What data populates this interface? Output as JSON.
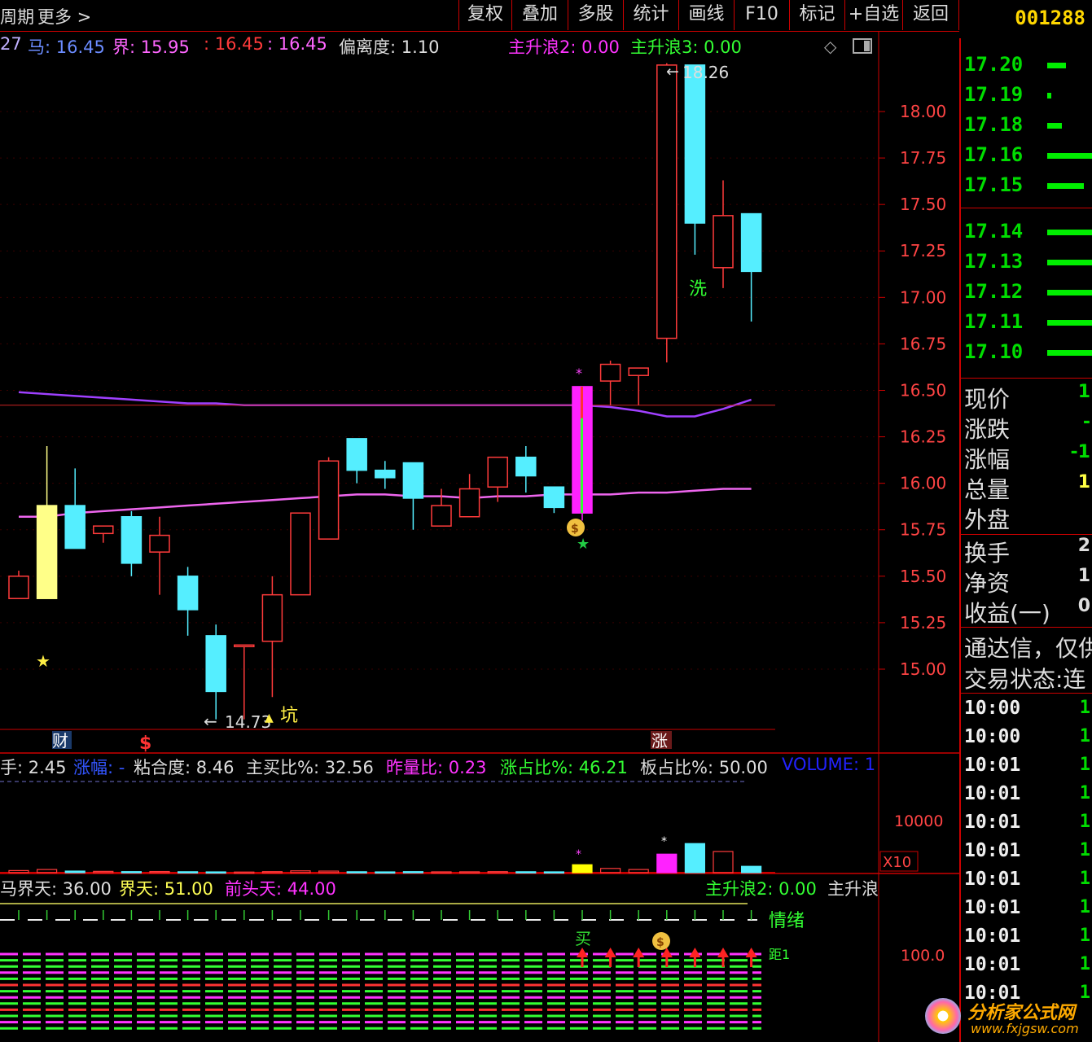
{
  "toolbar": {
    "left_items": [
      "周期",
      "更多 >"
    ],
    "buttons": [
      "复权",
      "叠加",
      "多股",
      "统计",
      "画线",
      "F10",
      "标记",
      "+自选",
      "返回"
    ]
  },
  "stock_code": "001288",
  "indicators": {
    "main": [
      {
        "text": "27",
        "color": "#c0b0ff"
      },
      {
        "text": "马: 16.45",
        "color": "#6b8cff"
      },
      {
        "text": "界: 15.95",
        "color": "#ff66ff"
      },
      {
        "text": ": 16.45",
        "color": "#ff3b3b"
      },
      {
        "text": ": 16.45",
        "color": "#ff66ff"
      },
      {
        "text": "偏离度: 1.10",
        "color": "#dddddd"
      },
      {
        "text": "主升浪2: 0.00",
        "color": "#ff33ff"
      },
      {
        "text": "主升浪3: 0.00",
        "color": "#33ff33"
      }
    ],
    "volume": [
      {
        "text": "手: 2.45",
        "color": "#dddddd"
      },
      {
        "text": "涨幅: -",
        "color": "#3355ff"
      },
      {
        "text": "粘合度: 8.46",
        "color": "#dddddd"
      },
      {
        "text": "主买比%: 32.56",
        "color": "#dddddd"
      },
      {
        "text": "昨量比: 0.23",
        "color": "#ff33ff"
      },
      {
        "text": "涨占比%: 46.21",
        "color": "#33ff33"
      },
      {
        "text": "板占比%: 50.00",
        "color": "#dddddd"
      },
      {
        "text": "VOLUME: 1",
        "color": "#2222ff"
      }
    ],
    "bottom": [
      {
        "text": "马界天: 36.00",
        "color": "#dddddd"
      },
      {
        "text": "界天: 51.00",
        "color": "#ffff55"
      },
      {
        "text": "前头天: 44.00",
        "color": "#ff33ff"
      },
      {
        "text": "主升浪2: 0.00",
        "color": "#33ff33"
      },
      {
        "text": "主升浪",
        "color": "#dddddd"
      }
    ]
  },
  "price_axis": [
    "18.00",
    "17.75",
    "17.50",
    "17.25",
    "17.00",
    "16.75",
    "16.50",
    "16.25",
    "16.00",
    "15.75",
    "15.50",
    "15.25",
    "15.00"
  ],
  "volume_axis": {
    "value": "10000",
    "multiplier": "X10"
  },
  "bottom_axis": {
    "value": "100.0"
  },
  "chart_labels": {
    "high_marker": "18.26",
    "low_marker": "14.73",
    "keng": "坑",
    "xi": "洗",
    "mai": "买",
    "qingxu": "情绪",
    "zhang": "涨",
    "cai": "财",
    "dollar": "$",
    "ju1": "距1"
  },
  "chart_data": {
    "type": "candlestick",
    "ylim": [
      14.6,
      18.4
    ],
    "candles": [
      {
        "o": 15.38,
        "c": 15.5,
        "h": 15.53,
        "l": 15.38
      },
      {
        "o": 15.38,
        "c": 15.88,
        "h": 16.2,
        "l": 15.38
      },
      {
        "o": 15.88,
        "c": 15.65,
        "h": 16.08,
        "l": 15.65
      },
      {
        "o": 15.73,
        "c": 15.77,
        "h": 15.77,
        "l": 15.68
      },
      {
        "o": 15.82,
        "c": 15.57,
        "h": 15.85,
        "l": 15.5
      },
      {
        "o": 15.63,
        "c": 15.72,
        "h": 15.82,
        "l": 15.4
      },
      {
        "o": 15.5,
        "c": 15.32,
        "h": 15.55,
        "l": 15.18
      },
      {
        "o": 15.18,
        "c": 14.88,
        "h": 15.24,
        "l": 14.73
      },
      {
        "o": 15.13,
        "c": 15.13,
        "h": 15.13,
        "l": 14.73
      },
      {
        "o": 15.15,
        "c": 15.4,
        "h": 15.5,
        "l": 14.85
      },
      {
        "o": 15.4,
        "c": 15.84,
        "h": 15.84,
        "l": 15.4
      },
      {
        "o": 15.7,
        "c": 16.12,
        "h": 16.14,
        "l": 15.7
      },
      {
        "o": 16.24,
        "c": 16.07,
        "h": 16.24,
        "l": 16.0
      },
      {
        "o": 16.07,
        "c": 16.03,
        "h": 16.12,
        "l": 15.97
      },
      {
        "o": 16.11,
        "c": 15.92,
        "h": 16.11,
        "l": 15.75
      },
      {
        "o": 15.77,
        "c": 15.88,
        "h": 15.97,
        "l": 15.77
      },
      {
        "o": 15.82,
        "c": 15.97,
        "h": 16.05,
        "l": 15.82
      },
      {
        "o": 15.98,
        "c": 16.14,
        "h": 16.14,
        "l": 15.9
      },
      {
        "o": 16.14,
        "c": 16.04,
        "h": 16.2,
        "l": 15.95
      },
      {
        "o": 15.98,
        "c": 15.87,
        "h": 15.98,
        "l": 15.84
      },
      {
        "o": 15.84,
        "c": 16.52,
        "h": 16.52,
        "l": 15.8
      },
      {
        "o": 16.55,
        "c": 16.64,
        "h": 16.66,
        "l": 16.42
      },
      {
        "o": 16.58,
        "c": 16.62,
        "h": 16.62,
        "l": 16.42
      },
      {
        "o": 16.78,
        "c": 18.25,
        "h": 18.26,
        "l": 16.65
      },
      {
        "o": 18.25,
        "c": 17.4,
        "h": 18.25,
        "l": 17.23
      },
      {
        "o": 17.16,
        "c": 17.44,
        "h": 17.63,
        "l": 17.05
      },
      {
        "o": 17.45,
        "c": 17.14,
        "h": 17.45,
        "l": 16.87
      }
    ],
    "ma_purple": [
      16.49,
      16.48,
      16.47,
      16.46,
      16.45,
      16.44,
      16.43,
      16.43,
      16.42,
      16.42,
      16.42,
      16.42,
      16.42,
      16.42,
      16.42,
      16.42,
      16.42,
      16.42,
      16.42,
      16.42,
      16.42,
      16.41,
      16.39,
      16.36,
      16.36,
      16.4,
      16.45
    ],
    "ma_pink": [
      15.82,
      15.82,
      15.84,
      15.85,
      15.86,
      15.87,
      15.88,
      15.89,
      15.9,
      15.91,
      15.92,
      15.93,
      15.94,
      15.94,
      15.93,
      15.93,
      15.92,
      15.93,
      15.93,
      15.94,
      15.94,
      15.94,
      15.95,
      15.95,
      15.96,
      15.97,
      15.97
    ],
    "volume_values": [
      400,
      600,
      300,
      250,
      200,
      220,
      180,
      150,
      120,
      200,
      350,
      300,
      180,
      150,
      200,
      160,
      170,
      200,
      180,
      160,
      1500,
      800,
      600,
      3500,
      5500,
      4000,
      1200
    ],
    "volume_ylim": [
      0,
      10000
    ]
  },
  "orderbook": [
    {
      "price": "17.20",
      "bar": 0.25
    },
    {
      "price": "17.19",
      "bar": 0.05
    },
    {
      "price": "17.18",
      "bar": 0.2
    },
    {
      "price": "17.16",
      "bar": 0.65
    },
    {
      "price": "17.15",
      "bar": 0.5
    },
    {
      "price": "17.14",
      "bar": 0.65
    },
    {
      "price": "17.13",
      "bar": 0.65
    },
    {
      "price": "17.12",
      "bar": 0.65
    },
    {
      "price": "17.11",
      "bar": 0.65
    },
    {
      "price": "17.10",
      "bar": 0.65
    }
  ],
  "info": [
    {
      "label": "现价",
      "value": "1",
      "color": "#00dd00"
    },
    {
      "label": "涨跌",
      "value": "-",
      "color": "#00dd00"
    },
    {
      "label": "涨幅",
      "value": "-1",
      "color": "#00dd00"
    },
    {
      "label": "总量",
      "value": "1",
      "color": "#ffff44"
    },
    {
      "label": "外盘",
      "value": "",
      "color": "#ff3333"
    },
    {
      "label": "换手",
      "value": "2",
      "color": "#dddddd"
    },
    {
      "label": "净资",
      "value": "1",
      "color": "#dddddd"
    },
    {
      "label": "收益(一)",
      "value": "0",
      "color": "#dddddd"
    }
  ],
  "notice": [
    "通达信，仅供",
    "交易状态:连"
  ],
  "ticks": [
    {
      "time": "10:00",
      "value": "1"
    },
    {
      "time": "10:00",
      "value": "1"
    },
    {
      "time": "10:01",
      "value": "1"
    },
    {
      "time": "10:01",
      "value": "1"
    },
    {
      "time": "10:01",
      "value": "1"
    },
    {
      "time": "10:01",
      "value": "1"
    },
    {
      "time": "10:01",
      "value": "1"
    },
    {
      "time": "10:01",
      "value": "1"
    },
    {
      "time": "10:01",
      "value": "1"
    },
    {
      "time": "10:01",
      "value": "1"
    },
    {
      "time": "10:01",
      "value": "1"
    }
  ],
  "watermark": {
    "title": "分析家公式网",
    "url": "www.fxjgsw.com"
  }
}
